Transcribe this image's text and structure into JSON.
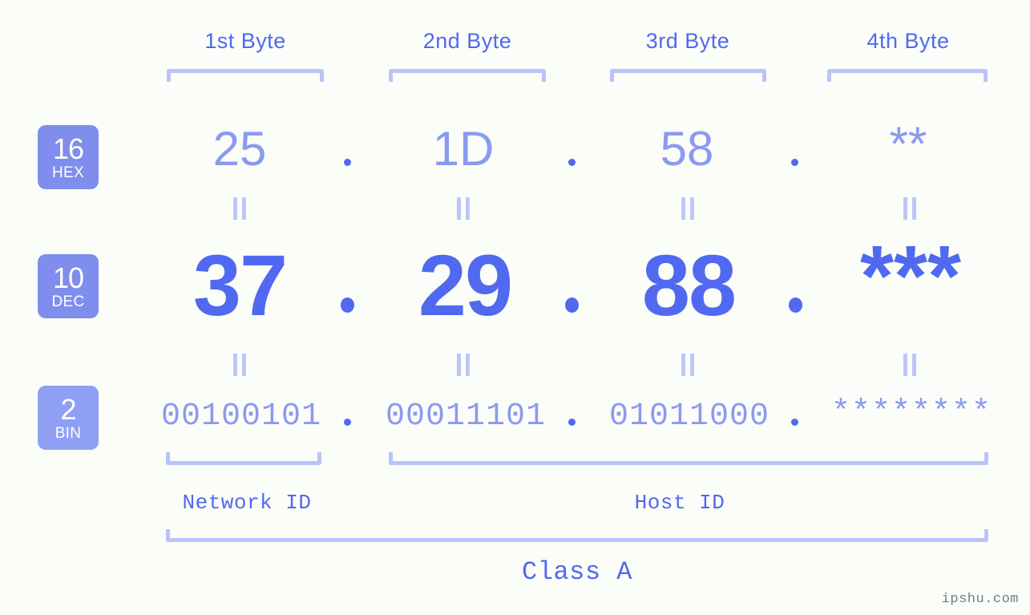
{
  "meta": {
    "background": "#fbfdf8",
    "accent_strong": "#5069f0",
    "accent_light": "#8b9af0",
    "accent_bracket": "#b9c3fb",
    "badge_bg": "#7f8ded",
    "badge_bg_bin": "#8fa0f4",
    "watermark": "ipshu.com"
  },
  "byte_headers": [
    {
      "label": "1st Byte"
    },
    {
      "label": "2nd Byte"
    },
    {
      "label": "3rd Byte"
    },
    {
      "label": "4th Byte"
    }
  ],
  "rows": [
    {
      "id": "hex",
      "badge_number": "16",
      "badge_name": "HEX",
      "values": [
        "25",
        "1D",
        "58",
        "**"
      ],
      "separator": "."
    },
    {
      "id": "dec",
      "badge_number": "10",
      "badge_name": "DEC",
      "values": [
        "37",
        "29",
        "88",
        "***"
      ],
      "separator": "."
    },
    {
      "id": "bin",
      "badge_number": "2",
      "badge_name": "BIN",
      "values": [
        "00100101",
        "00011101",
        "01011000",
        "********"
      ],
      "separator": "."
    }
  ],
  "equality_marker": "=",
  "sections": [
    {
      "id": "network-id",
      "label": "Network ID"
    },
    {
      "id": "host-id",
      "label": "Host ID"
    }
  ],
  "class_label": "Class A"
}
